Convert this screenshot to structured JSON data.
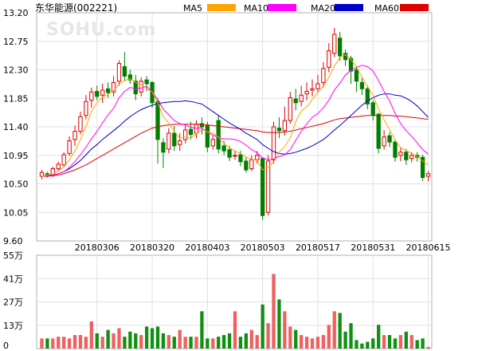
{
  "chart_data": [
    {
      "type": "candlestick",
      "title": "东华能源(002221)",
      "watermark": "SOHU.com",
      "ylim": [
        9.6,
        13.2
      ],
      "y_ticks": [
        "13.20",
        "12.75",
        "12.30",
        "11.85",
        "11.40",
        "10.95",
        "10.50",
        "10.05",
        "9.60"
      ],
      "x_ticks": [
        "20180306",
        "20180320",
        "20180403",
        "20180503",
        "20180517",
        "20180531",
        "20180615"
      ],
      "x_tick_index": [
        10,
        20,
        30,
        40,
        50,
        60,
        70
      ],
      "legend": [
        {
          "name": "MA5",
          "color": "#ffa500"
        },
        {
          "name": "MA10",
          "color": "#ff00ff"
        },
        {
          "name": "MA20",
          "color": "#0000cd"
        },
        {
          "name": "MA60",
          "color": "#e00000"
        }
      ],
      "up_color": "#e00000",
      "down_color": "#008000",
      "candles": [
        [
          10.62,
          10.68,
          10.57,
          10.72
        ],
        [
          10.66,
          10.63,
          10.6,
          10.69
        ],
        [
          10.64,
          10.74,
          10.61,
          10.77
        ],
        [
          10.74,
          10.81,
          10.7,
          10.85
        ],
        [
          10.8,
          10.96,
          10.76,
          11.0
        ],
        [
          10.98,
          11.18,
          10.94,
          11.25
        ],
        [
          11.2,
          11.33,
          11.1,
          11.42
        ],
        [
          11.33,
          11.56,
          11.28,
          11.64
        ],
        [
          11.58,
          11.8,
          11.52,
          11.9
        ],
        [
          11.82,
          11.95,
          11.7,
          12.02
        ],
        [
          11.96,
          11.88,
          11.82,
          12.05
        ],
        [
          11.9,
          11.98,
          11.78,
          12.08
        ],
        [
          12.0,
          11.94,
          11.86,
          12.1
        ],
        [
          11.95,
          12.1,
          11.88,
          12.2
        ],
        [
          12.12,
          12.4,
          12.05,
          12.45
        ],
        [
          12.35,
          12.2,
          12.12,
          12.58
        ],
        [
          12.22,
          12.14,
          12.08,
          12.3
        ],
        [
          12.12,
          11.92,
          11.82,
          12.22
        ],
        [
          11.95,
          12.12,
          11.88,
          12.18
        ],
        [
          12.14,
          12.08,
          11.96,
          12.2
        ],
        [
          12.1,
          11.78,
          11.7,
          12.12
        ],
        [
          11.8,
          11.2,
          10.82,
          11.85
        ],
        [
          11.15,
          11.0,
          10.75,
          11.22
        ],
        [
          11.05,
          11.3,
          10.98,
          11.38
        ],
        [
          11.3,
          11.1,
          11.02,
          11.42
        ],
        [
          11.12,
          11.18,
          11.02,
          11.3
        ],
        [
          11.2,
          11.35,
          11.14,
          11.42
        ],
        [
          11.36,
          11.28,
          11.2,
          11.48
        ],
        [
          11.3,
          11.44,
          11.22,
          11.5
        ],
        [
          11.45,
          11.4,
          11.28,
          11.55
        ],
        [
          11.42,
          11.08,
          11.0,
          11.48
        ],
        [
          11.1,
          11.2,
          11.04,
          11.26
        ],
        [
          11.5,
          11.05,
          10.98,
          11.58
        ],
        [
          11.1,
          11.02,
          10.95,
          11.18
        ],
        [
          11.04,
          10.92,
          10.86,
          11.1
        ],
        [
          10.95,
          10.95,
          10.88,
          11.02
        ],
        [
          10.96,
          10.85,
          10.78,
          11.02
        ],
        [
          10.86,
          10.72,
          10.68,
          10.92
        ],
        [
          10.74,
          10.88,
          10.7,
          10.95
        ],
        [
          10.88,
          10.95,
          10.82,
          11.02
        ],
        [
          10.9,
          10.0,
          9.93,
          10.92
        ],
        [
          10.05,
          10.86,
          10.0,
          10.95
        ],
        [
          10.88,
          11.4,
          10.82,
          11.48
        ],
        [
          11.38,
          11.34,
          11.22,
          11.55
        ],
        [
          11.34,
          11.5,
          11.26,
          11.72
        ],
        [
          11.5,
          11.86,
          11.45,
          11.95
        ],
        [
          11.84,
          11.78,
          11.66,
          12.0
        ],
        [
          11.8,
          11.9,
          11.72,
          12.05
        ],
        [
          11.92,
          11.96,
          11.82,
          12.1
        ],
        [
          11.98,
          12.0,
          11.88,
          12.15
        ],
        [
          12.0,
          12.08,
          11.94,
          12.22
        ],
        [
          12.1,
          12.32,
          12.02,
          12.42
        ],
        [
          12.34,
          12.6,
          12.26,
          12.72
        ],
        [
          12.56,
          12.86,
          12.5,
          12.96
        ],
        [
          12.8,
          12.52,
          12.44,
          12.9
        ],
        [
          12.56,
          12.46,
          12.36,
          12.62
        ],
        [
          12.48,
          12.28,
          12.08,
          12.52
        ],
        [
          12.3,
          12.12,
          11.95,
          12.36
        ],
        [
          12.1,
          12.0,
          11.9,
          12.18
        ],
        [
          12.0,
          11.76,
          11.68,
          12.05
        ],
        [
          11.78,
          11.58,
          11.5,
          11.82
        ],
        [
          11.6,
          11.06,
          10.98,
          11.62
        ],
        [
          11.1,
          11.24,
          11.04,
          11.35
        ],
        [
          11.26,
          11.16,
          11.08,
          11.32
        ],
        [
          11.16,
          10.92,
          10.85,
          11.2
        ],
        [
          10.95,
          11.0,
          10.86,
          11.08
        ],
        [
          11.0,
          10.88,
          10.8,
          11.05
        ],
        [
          10.9,
          10.95,
          10.84,
          11.0
        ],
        [
          10.95,
          10.92,
          10.85,
          11.0
        ],
        [
          10.92,
          10.6,
          10.55,
          10.96
        ],
        [
          10.62,
          10.66,
          10.54,
          10.7
        ]
      ],
      "ma5": [
        10.62,
        10.64,
        10.66,
        10.7,
        10.77,
        10.88,
        11.02,
        11.2,
        11.41,
        11.64,
        11.78,
        11.87,
        11.91,
        11.97,
        12.07,
        12.13,
        12.16,
        12.1,
        12.06,
        12.0,
        11.95,
        11.78,
        11.56,
        11.46,
        11.33,
        11.22,
        11.24,
        11.22,
        11.29,
        11.36,
        11.32,
        11.3,
        11.24,
        11.14,
        11.07,
        11.02,
        10.98,
        10.92,
        10.89,
        10.87,
        10.72,
        10.76,
        10.85,
        11.0,
        11.09,
        11.23,
        11.48,
        11.65,
        11.72,
        11.83,
        11.94,
        12.04,
        12.18,
        12.36,
        12.5,
        12.54,
        12.46,
        12.35,
        12.18,
        12.04,
        11.9,
        11.68,
        11.51,
        11.36,
        11.19,
        11.07,
        11.03,
        10.98,
        10.93,
        10.86,
        10.8
      ],
      "ma10": [
        10.62,
        10.63,
        10.64,
        10.66,
        10.69,
        10.76,
        10.85,
        10.96,
        11.08,
        11.21,
        11.33,
        11.46,
        11.59,
        11.69,
        11.86,
        11.96,
        12.02,
        12.0,
        12.01,
        12.04,
        11.95,
        11.83,
        11.68,
        11.59,
        11.5,
        11.45,
        11.43,
        11.39,
        11.38,
        11.38,
        11.31,
        11.27,
        11.23,
        11.21,
        11.21,
        11.2,
        11.17,
        11.11,
        11.04,
        10.99,
        10.91,
        10.88,
        10.89,
        10.93,
        10.96,
        11.04,
        11.19,
        11.33,
        11.45,
        11.55,
        11.61,
        11.7,
        11.82,
        11.98,
        12.09,
        12.22,
        12.29,
        12.34,
        12.37,
        12.35,
        12.28,
        12.13,
        11.96,
        11.81,
        11.61,
        11.45,
        11.34,
        11.25,
        11.15,
        11.04,
        10.97
      ],
      "ma20": [
        10.62,
        10.63,
        10.64,
        10.66,
        10.69,
        10.74,
        10.8,
        10.87,
        10.96,
        11.05,
        11.12,
        11.2,
        11.27,
        11.34,
        11.41,
        11.49,
        11.56,
        11.62,
        11.67,
        11.71,
        11.74,
        11.77,
        11.78,
        11.79,
        11.8,
        11.8,
        11.81,
        11.8,
        11.78,
        11.76,
        11.7,
        11.64,
        11.58,
        11.52,
        11.46,
        11.41,
        11.36,
        11.3,
        11.25,
        11.2,
        11.12,
        11.06,
        11.01,
        10.98,
        10.97,
        10.98,
        11.0,
        11.03,
        11.06,
        11.1,
        11.15,
        11.2,
        11.27,
        11.35,
        11.42,
        11.5,
        11.58,
        11.66,
        11.74,
        11.81,
        11.86,
        11.9,
        11.92,
        11.92,
        11.9,
        11.89,
        11.85,
        11.8,
        11.73,
        11.64,
        11.55
      ],
      "ma60": [
        10.62,
        10.62,
        10.63,
        10.64,
        10.66,
        10.69,
        10.72,
        10.76,
        10.8,
        10.85,
        10.9,
        10.95,
        11.0,
        11.05,
        11.1,
        11.15,
        11.2,
        11.25,
        11.3,
        11.34,
        11.38,
        11.4,
        11.42,
        11.43,
        11.44,
        11.44,
        11.44,
        11.44,
        11.44,
        11.44,
        11.43,
        11.42,
        11.41,
        11.4,
        11.39,
        11.38,
        11.37,
        11.36,
        11.35,
        11.34,
        11.32,
        11.31,
        11.31,
        11.31,
        11.32,
        11.33,
        11.35,
        11.37,
        11.39,
        11.41,
        11.43,
        11.45,
        11.48,
        11.51,
        11.53,
        11.54,
        11.55,
        11.56,
        11.57,
        11.58,
        11.58,
        11.58,
        11.58,
        11.58,
        11.57,
        11.57,
        11.56,
        11.55,
        11.54,
        11.53,
        11.52
      ]
    },
    {
      "type": "bar",
      "y_ticks": [
        "55万",
        "41万",
        "27万",
        "13万",
        "0"
      ],
      "ylim": [
        0,
        55
      ],
      "volumes": [
        6,
        6,
        6,
        7,
        7,
        6,
        8,
        8,
        7,
        16,
        9,
        7,
        11,
        9,
        12,
        7,
        10,
        9,
        8,
        13,
        12,
        13,
        9,
        8,
        7,
        11,
        7,
        7,
        7,
        22,
        6,
        6,
        7,
        8,
        9,
        22,
        7,
        9,
        11,
        8,
        26,
        15,
        44,
        29,
        22,
        13,
        11,
        8,
        7,
        6,
        7,
        8,
        14,
        22,
        21,
        10,
        15,
        5,
        3,
        4,
        6,
        14,
        8,
        8,
        6,
        8,
        10,
        8,
        5,
        6,
        1
      ]
    }
  ]
}
